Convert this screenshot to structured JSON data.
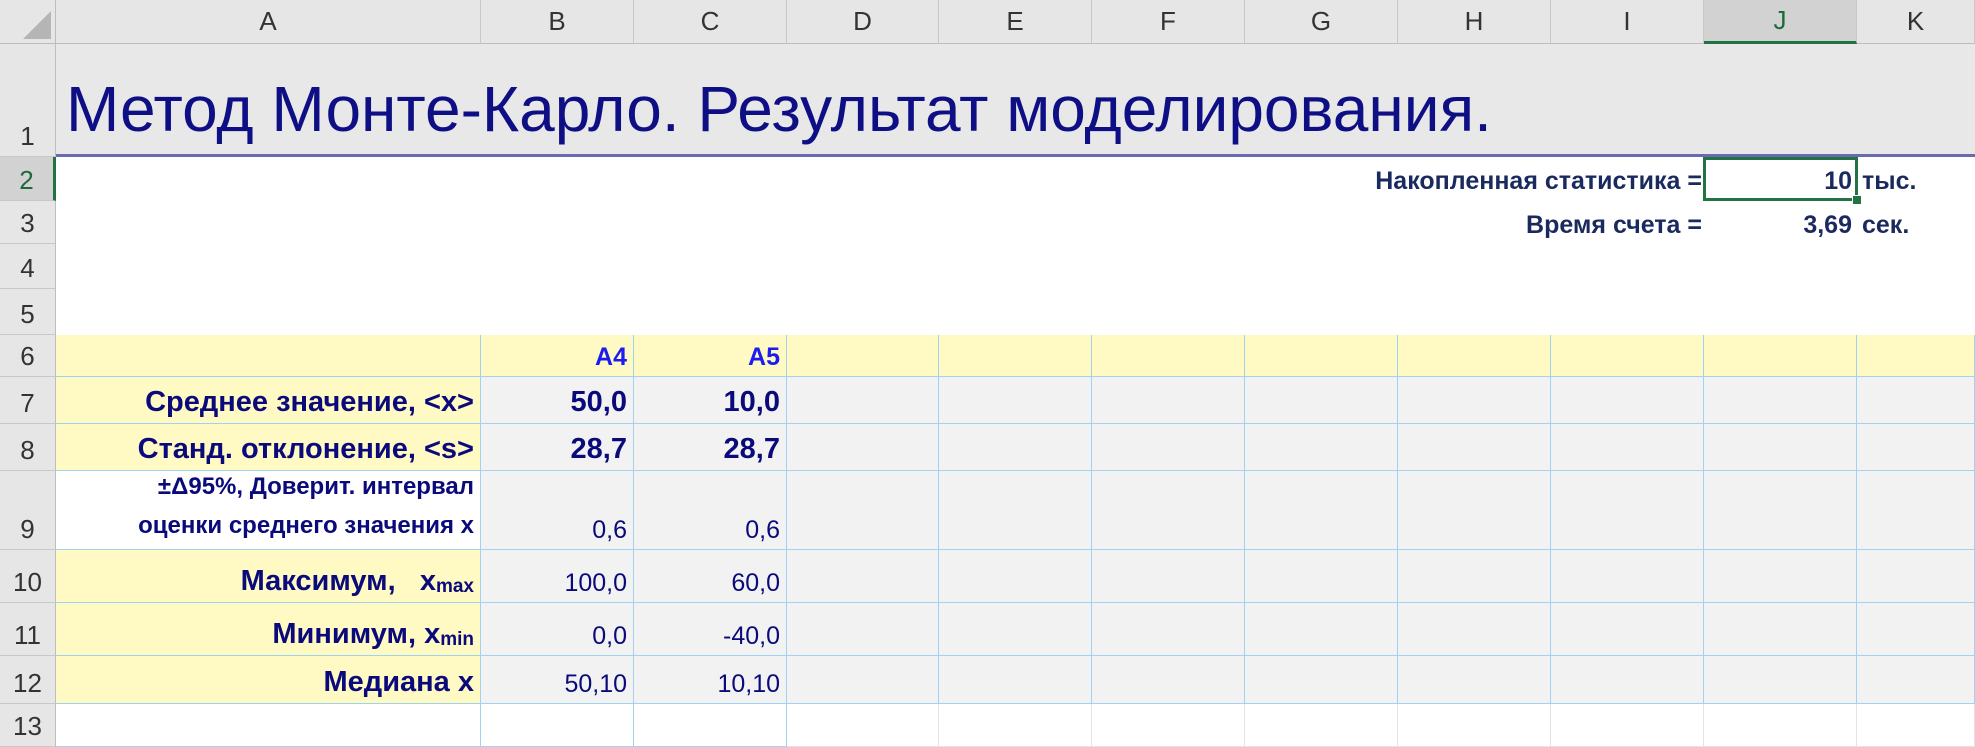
{
  "sheet": {
    "columns": [
      "A",
      "B",
      "C",
      "D",
      "E",
      "F",
      "G",
      "H",
      "I",
      "J",
      "K"
    ],
    "rows": [
      "1",
      "2",
      "3",
      "4",
      "5",
      "6",
      "7",
      "8",
      "9",
      "10",
      "11",
      "12",
      "13"
    ],
    "selected_column": "J",
    "selected_row": "2"
  },
  "title": "Метод Монте-Карло. Результат моделирования.",
  "stats": {
    "accum_label": "Накопленная статистика =",
    "accum_value": "10",
    "accum_unit": "тыс.",
    "time_label": "Время счета =",
    "time_value": "3,69",
    "time_unit": "сек."
  },
  "table": {
    "headers": [
      "A4",
      "A5"
    ],
    "rows": [
      {
        "label": "Среднее значение, <x>",
        "values": [
          "50,0",
          "10,0"
        ]
      },
      {
        "label": "Станд. отклонение, <s>",
        "values": [
          "28,7",
          "28,7"
        ]
      },
      {
        "label_line1": "±Δ95%, Доверит. интервал",
        "label_line2": "оценки среднего значения x",
        "values": [
          "0,6",
          "0,6"
        ]
      },
      {
        "label": "Максимум,   x",
        "sub": "max",
        "values": [
          "100,0",
          "60,0"
        ]
      },
      {
        "label": "Минимум, x",
        "sub": "min",
        "values": [
          "0,0",
          "-40,0"
        ]
      },
      {
        "label": "Медиана x",
        "values": [
          "50,10",
          "10,10"
        ]
      }
    ]
  },
  "colors": {
    "header_band": "#fff9c4",
    "data_band": "#f2f2f2",
    "accent": "#217346",
    "text": "#141480"
  }
}
